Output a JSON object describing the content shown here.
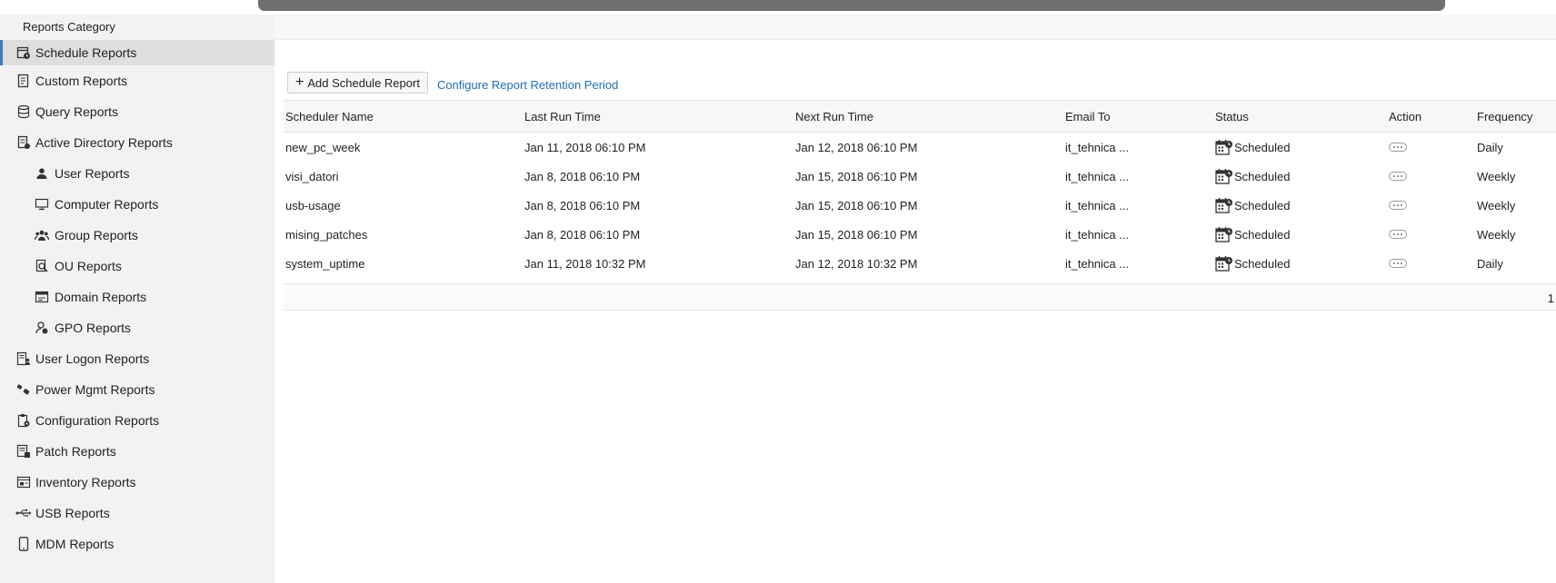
{
  "sidebar": {
    "header": "Reports Category",
    "items": [
      {
        "label": "Schedule Reports",
        "icon": "schedule-reports-icon",
        "active": true,
        "sub": false
      },
      {
        "label": "Custom Reports",
        "icon": "custom-reports-icon",
        "active": false,
        "sub": false
      },
      {
        "label": "Query Reports",
        "icon": "query-reports-icon",
        "active": false,
        "sub": false
      },
      {
        "label": "Active Directory Reports",
        "icon": "active-directory-icon",
        "active": false,
        "sub": false
      },
      {
        "label": "User Reports",
        "icon": "user-icon",
        "active": false,
        "sub": true
      },
      {
        "label": "Computer Reports",
        "icon": "computer-icon",
        "active": false,
        "sub": true
      },
      {
        "label": "Group Reports",
        "icon": "group-icon",
        "active": false,
        "sub": true
      },
      {
        "label": "OU Reports",
        "icon": "ou-icon",
        "active": false,
        "sub": true
      },
      {
        "label": "Domain Reports",
        "icon": "domain-icon",
        "active": false,
        "sub": true
      },
      {
        "label": "GPO Reports",
        "icon": "gpo-icon",
        "active": false,
        "sub": true
      },
      {
        "label": "User Logon Reports",
        "icon": "user-logon-icon",
        "active": false,
        "sub": false
      },
      {
        "label": "Power Mgmt Reports",
        "icon": "power-icon",
        "active": false,
        "sub": false
      },
      {
        "label": "Configuration Reports",
        "icon": "configuration-icon",
        "active": false,
        "sub": false
      },
      {
        "label": "Patch Reports",
        "icon": "patch-icon",
        "active": false,
        "sub": false
      },
      {
        "label": "Inventory Reports",
        "icon": "inventory-icon",
        "active": false,
        "sub": false
      },
      {
        "label": "USB Reports",
        "icon": "usb-icon",
        "active": false,
        "sub": false
      },
      {
        "label": "MDM Reports",
        "icon": "mobile-device-icon",
        "active": false,
        "sub": false
      }
    ]
  },
  "toolbar": {
    "add_label": "Add Schedule Report",
    "retention_link": "Configure Report Retention Period"
  },
  "table": {
    "columns": [
      "Scheduler Name",
      "Last Run Time",
      "Next Run Time",
      "Email To",
      "Status",
      "Action",
      "Frequency"
    ],
    "rows": [
      {
        "name": "new_pc_week",
        "last_run": "Jan 11, 2018 06:10 PM",
        "next_run": "Jan 12, 2018 06:10 PM",
        "email": "it_tehnica ...",
        "status": "Scheduled",
        "frequency": "Daily"
      },
      {
        "name": "visi_datori",
        "last_run": "Jan 8, 2018 06:10 PM",
        "next_run": "Jan 15, 2018 06:10 PM",
        "email": "it_tehnica ...",
        "status": "Scheduled",
        "frequency": "Weekly"
      },
      {
        "name": "usb-usage",
        "last_run": "Jan 8, 2018 06:10 PM",
        "next_run": "Jan 15, 2018 06:10 PM",
        "email": "it_tehnica ...",
        "status": "Scheduled",
        "frequency": "Weekly"
      },
      {
        "name": "mising_patches",
        "last_run": "Jan 8, 2018 06:10 PM",
        "next_run": "Jan 15, 2018 06:10 PM",
        "email": "it_tehnica ...",
        "status": "Scheduled",
        "frequency": "Weekly"
      },
      {
        "name": "system_uptime",
        "last_run": "Jan 11, 2018 10:32 PM",
        "next_run": "Jan 12, 2018 10:32 PM",
        "email": "it_tehnica ...",
        "status": "Scheduled",
        "frequency": "Daily"
      }
    ],
    "page_number": "1"
  },
  "colors": {
    "accent": "#3a78c3",
    "link": "#1f6eb5",
    "sidebar_bg": "#f2f2f2",
    "active_bg": "#dedede"
  }
}
